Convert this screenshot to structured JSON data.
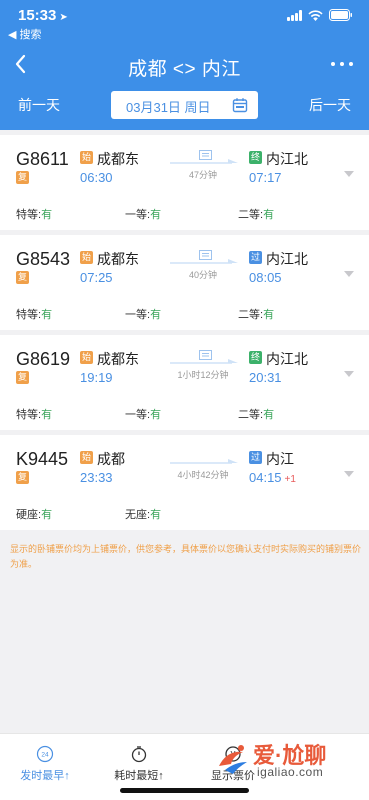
{
  "status_bar": {
    "time": "15:33",
    "back_app": "◀ 搜索"
  },
  "nav": {
    "title": "成都 <> 内江"
  },
  "date_bar": {
    "prev_label": "前一天",
    "date": "03月31日 周日",
    "next_label": "后一天"
  },
  "trains": [
    {
      "number": "G8611",
      "type_badge": "复",
      "from_badge": "始",
      "from": "成都东",
      "depart": "06:30",
      "duration": "47分钟",
      "to_badge": "终",
      "to": "内江北",
      "arrive": "07:17",
      "next_day": "",
      "seats": [
        {
          "name": "特等:",
          "avail": "有"
        },
        {
          "name": "一等:",
          "avail": "有"
        },
        {
          "name": "二等:",
          "avail": "有"
        }
      ]
    },
    {
      "number": "G8543",
      "type_badge": "复",
      "from_badge": "始",
      "from": "成都东",
      "depart": "07:25",
      "duration": "40分钟",
      "to_badge": "过",
      "to": "内江北",
      "arrive": "08:05",
      "next_day": "",
      "seats": [
        {
          "name": "特等:",
          "avail": "有"
        },
        {
          "name": "一等:",
          "avail": "有"
        },
        {
          "name": "二等:",
          "avail": "有"
        }
      ]
    },
    {
      "number": "G8619",
      "type_badge": "复",
      "from_badge": "始",
      "from": "成都东",
      "depart": "19:19",
      "duration": "1小时12分钟",
      "to_badge": "终",
      "to": "内江北",
      "arrive": "20:31",
      "next_day": "",
      "seats": [
        {
          "name": "特等:",
          "avail": "有"
        },
        {
          "name": "一等:",
          "avail": "有"
        },
        {
          "name": "二等:",
          "avail": "有"
        }
      ]
    },
    {
      "number": "K9445",
      "type_badge": "复",
      "from_badge": "始",
      "from": "成都",
      "depart": "23:33",
      "duration": "4小时42分钟",
      "to_badge": "过",
      "to": "内江",
      "arrive": "04:15",
      "next_day": "+1",
      "seats": [
        {
          "name": "硬座:",
          "avail": "有"
        },
        {
          "name": "无座:",
          "avail": "有"
        }
      ]
    }
  ],
  "notice": "显示的卧铺票价均为上铺票价，供您参考，具体票价以您确认支付时实际购买的铺别票价为准。",
  "bottom_tabs": [
    {
      "label": "发时最早↑",
      "icon": "clock-24-icon"
    },
    {
      "label": "耗时最短↑",
      "icon": "stopwatch-icon"
    },
    {
      "label": "显示票价",
      "icon": "price-icon"
    }
  ],
  "watermark": {
    "text": "爱·尬聊",
    "url": "igaliao.com"
  },
  "colors": {
    "primary": "#3d8fe8",
    "accent_blue": "#4a90e2",
    "available_green": "#3aa55a",
    "notice_orange": "#f0a04a",
    "next_day_red": "#e85a5a"
  }
}
